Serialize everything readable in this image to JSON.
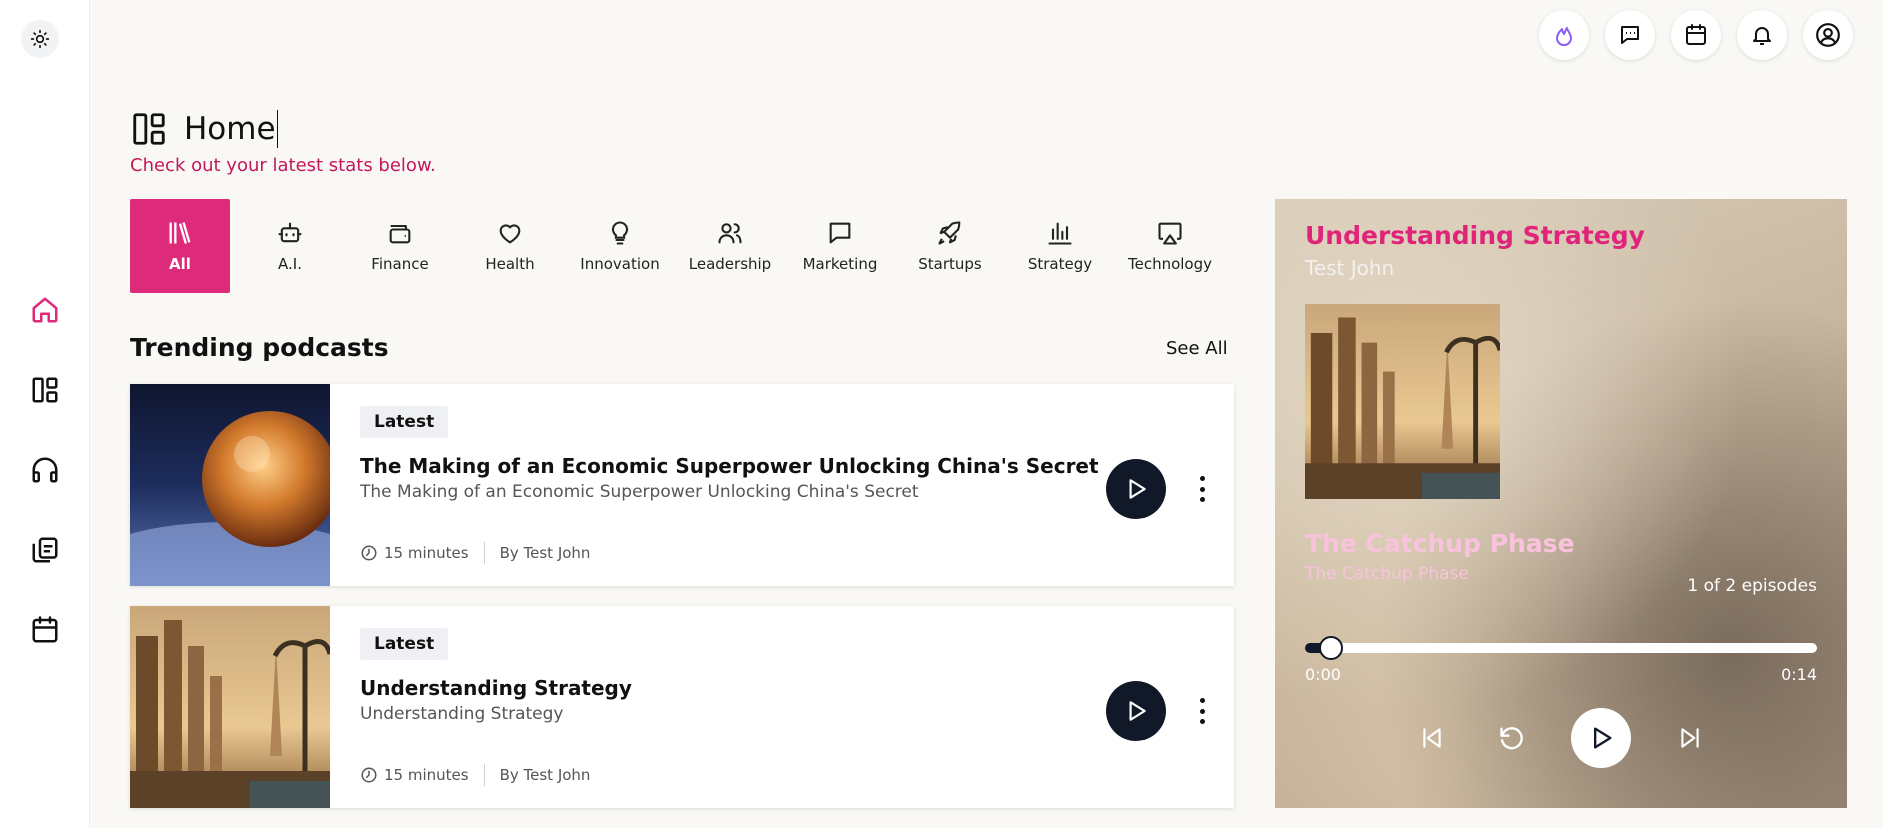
{
  "header": {
    "title": "Home",
    "subtitle": "Check out your latest stats below."
  },
  "sidebar": {
    "theme_icon": "sun-icon",
    "items": [
      {
        "name": "home",
        "icon": "home-icon",
        "active": true
      },
      {
        "name": "dashboard",
        "icon": "layout-icon",
        "active": false
      },
      {
        "name": "podcasts",
        "icon": "headphones-icon",
        "active": false
      },
      {
        "name": "library",
        "icon": "copy-icon",
        "active": false
      },
      {
        "name": "calendar",
        "icon": "calendar-icon",
        "active": false
      }
    ]
  },
  "top_bar": {
    "icons": [
      "flame-icon",
      "message-icon",
      "calendar-icon",
      "bell-icon",
      "user-circle-icon"
    ]
  },
  "categories": [
    {
      "label": "All",
      "icon": "books-icon",
      "active": true
    },
    {
      "label": "A.I.",
      "icon": "robot-icon",
      "active": false
    },
    {
      "label": "Finance",
      "icon": "wallet-icon",
      "active": false
    },
    {
      "label": "Health",
      "icon": "heart-icon",
      "active": false
    },
    {
      "label": "Innovation",
      "icon": "bulb-icon",
      "active": false
    },
    {
      "label": "Leadership",
      "icon": "users-icon",
      "active": false
    },
    {
      "label": "Marketing",
      "icon": "message-icon",
      "active": false
    },
    {
      "label": "Startups",
      "icon": "rocket-icon",
      "active": false
    },
    {
      "label": "Strategy",
      "icon": "bar-chart-icon",
      "active": false
    },
    {
      "label": "Technology",
      "icon": "airplay-icon",
      "active": false
    }
  ],
  "trending": {
    "title": "Trending podcasts",
    "see_all": "See All",
    "items": [
      {
        "badge": "Latest",
        "title": "The Making of an Economic Superpower Unlocking China's Secret",
        "subtitle": "The Making of an Economic Superpower Unlocking China's Secret",
        "duration": "15 minutes",
        "author": "By Test John"
      },
      {
        "badge": "Latest",
        "title": "Understanding Strategy",
        "subtitle": "Understanding Strategy",
        "duration": "15 minutes",
        "author": "By Test John"
      }
    ]
  },
  "player": {
    "podcast_title": "Understanding Strategy",
    "artist": "Test John",
    "episode_title": "The Catchup Phase",
    "episode_subtitle": "The Catchup Phase",
    "episode_count": "1 of 2 episodes",
    "progress_percent": 5,
    "current_time": "0:00",
    "total_time": "0:14"
  },
  "colors": {
    "accent": "#dd2a7b",
    "subtitle": "#c2185b",
    "dark": "#111827",
    "episode_title": "#f9c3dd"
  }
}
